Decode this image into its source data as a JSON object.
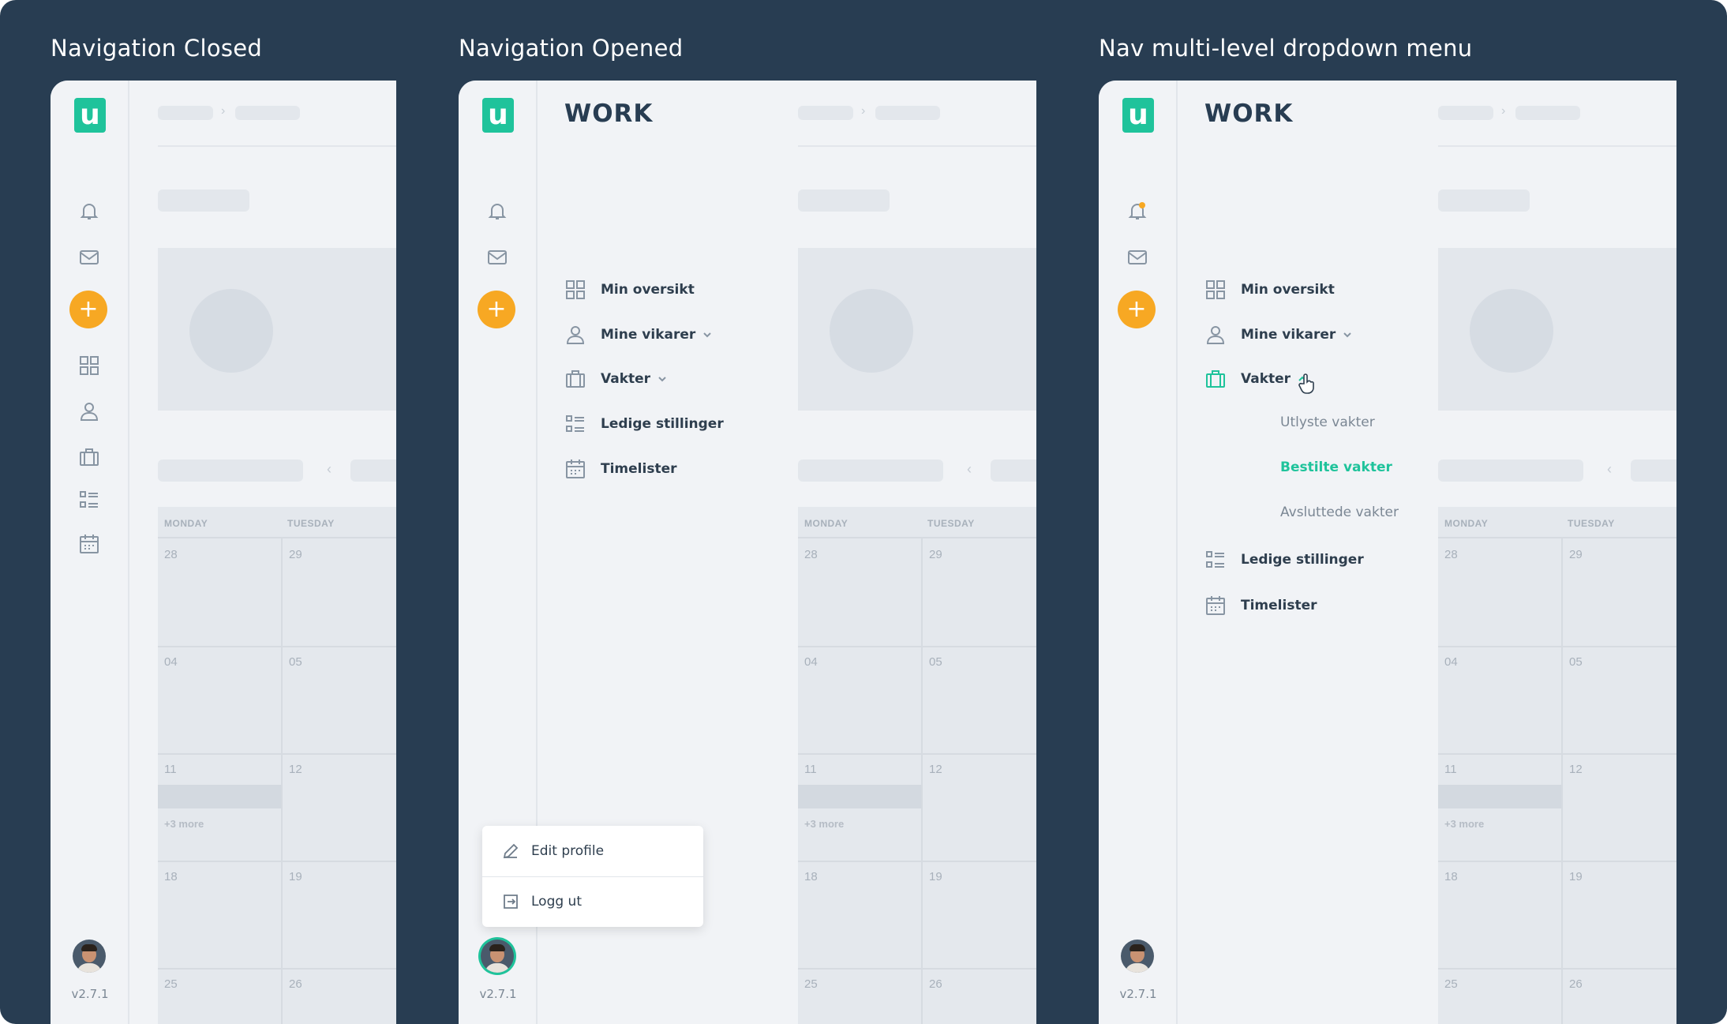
{
  "panels": [
    {
      "title": "Navigation Closed"
    },
    {
      "title": "Navigation Opened"
    },
    {
      "title": "Nav multi-level dropdown menu"
    }
  ],
  "app": {
    "logo_letter": "u",
    "section_title": "WORK",
    "version": "v2.7.1",
    "fab_label": "+",
    "accent_color": "#1fc39b",
    "fab_color": "#f7a823",
    "notification_dot_color": "#f7a823"
  },
  "nav": {
    "items": [
      {
        "label": "Min oversikt",
        "icon": "grid-icon"
      },
      {
        "label": "Mine vikarer",
        "icon": "person-icon",
        "expandable": true
      },
      {
        "label": "Vakter",
        "icon": "briefcase-icon",
        "expandable": true
      },
      {
        "label": "Ledige stillinger",
        "icon": "list-icon"
      },
      {
        "label": "Timelister",
        "icon": "calendar-icon"
      }
    ],
    "vakter_sub": [
      {
        "label": "Utlyste vakter",
        "active": false
      },
      {
        "label": "Bestilte vakter",
        "active": true
      },
      {
        "label": "Avsluttede vakter",
        "active": false
      }
    ]
  },
  "profile_menu": {
    "edit_label": "Edit profile",
    "logout_label": "Logg ut"
  },
  "calendar": {
    "day_names": [
      "MONDAY",
      "TUESDAY"
    ],
    "rows": [
      [
        "28",
        "29"
      ],
      [
        "04",
        "05"
      ],
      [
        "11",
        "12"
      ],
      [
        "18",
        "19"
      ],
      [
        "25",
        "26"
      ]
    ],
    "more_label": "+3 more"
  }
}
